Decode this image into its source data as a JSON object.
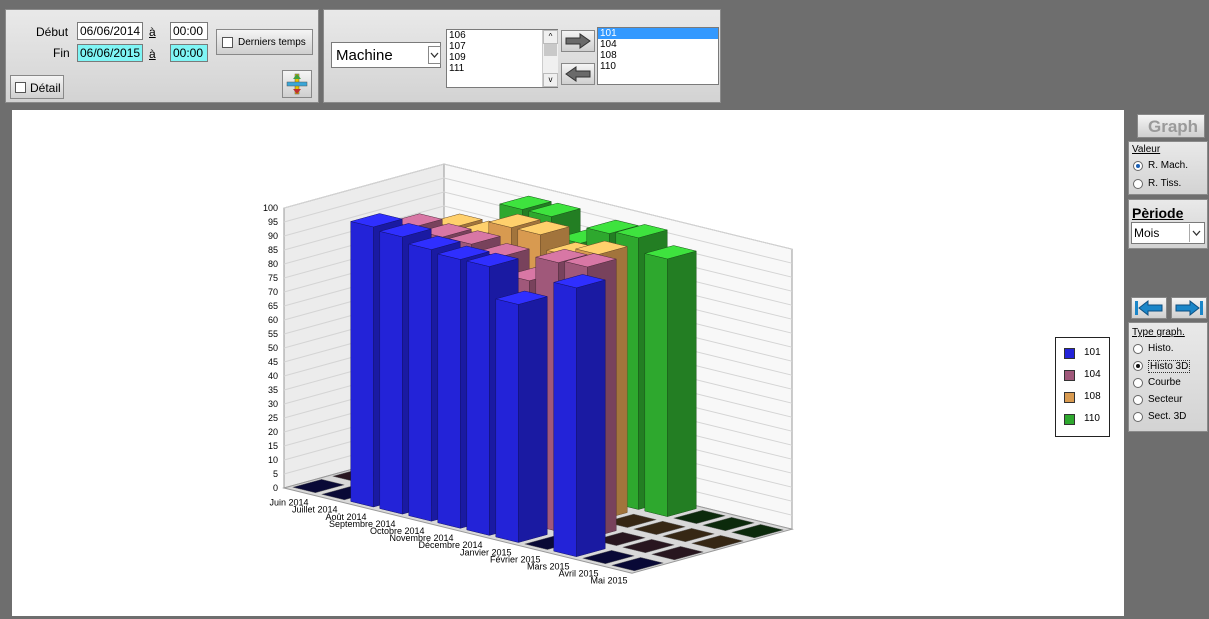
{
  "filters": {
    "debut_label": "Début",
    "debut_date": "06/06/2014",
    "a1_label": "à",
    "debut_time": "00:00",
    "fin_label": "Fin",
    "fin_date": "06/06/2015",
    "a2_label": "à",
    "fin_time": "00:00",
    "derniers_temps_label": "Derniers temps",
    "derniers_temps_checked": false,
    "detail_label": "Détail",
    "detail_checked": false
  },
  "selector": {
    "group_value": "Machine",
    "available": [
      "106",
      "107",
      "109",
      "111"
    ],
    "selected": [
      "101",
      "104",
      "108",
      "110"
    ],
    "highlighted": "101"
  },
  "side": {
    "graph_label": "Graph",
    "valeur_title": "Valeur",
    "valeur_options": [
      "R. Mach.",
      "R. Tiss."
    ],
    "valeur_selected": "R. Mach.",
    "periode_title": "Pèriode",
    "periode_value": "Mois",
    "type_title": "Type graph.",
    "type_options": [
      "Histo.",
      "Histo 3D",
      "Courbe",
      "Secteur",
      "Sect. 3D"
    ],
    "type_selected": "Histo 3D"
  },
  "chart_data": {
    "type": "bar",
    "style": "3d",
    "categories": [
      "Juin 2014",
      "Juillet 2014",
      "Août 2014",
      "Septembre 2014",
      "Octobre 2014",
      "Novembre 2014",
      "Décembre 2014",
      "Janvier 2015",
      "Février 2015",
      "Mars 2015",
      "Avril 2015",
      "Mai 2015"
    ],
    "y_ticks": [
      "0",
      "5",
      "10",
      "15",
      "20",
      "25",
      "30",
      "35",
      "40",
      "45",
      "50",
      "55",
      "60",
      "65",
      "70",
      "75",
      "80",
      "85",
      "90",
      "95",
      "100"
    ],
    "ylim": [
      0,
      100
    ],
    "legend_position": "right",
    "series": [
      {
        "name": "101",
        "color": "#2323d8",
        "values": [
          0,
          0,
          100,
          99,
          97,
          96,
          96,
          85,
          0,
          96,
          0,
          0
        ]
      },
      {
        "name": "104",
        "color": "#a0587a",
        "values": [
          0,
          0,
          96,
          95,
          95,
          93,
          87,
          96,
          97,
          0,
          0,
          0
        ]
      },
      {
        "name": "108",
        "color": "#d89a50",
        "values": [
          0,
          0,
          92,
          92,
          97,
          97,
          92,
          95,
          0,
          0,
          0,
          0
        ]
      },
      {
        "name": "110",
        "color": "#2ea82e",
        "values": [
          0,
          0,
          0,
          97,
          97,
          90,
          96,
          97,
          92,
          0,
          0,
          0
        ]
      }
    ]
  }
}
